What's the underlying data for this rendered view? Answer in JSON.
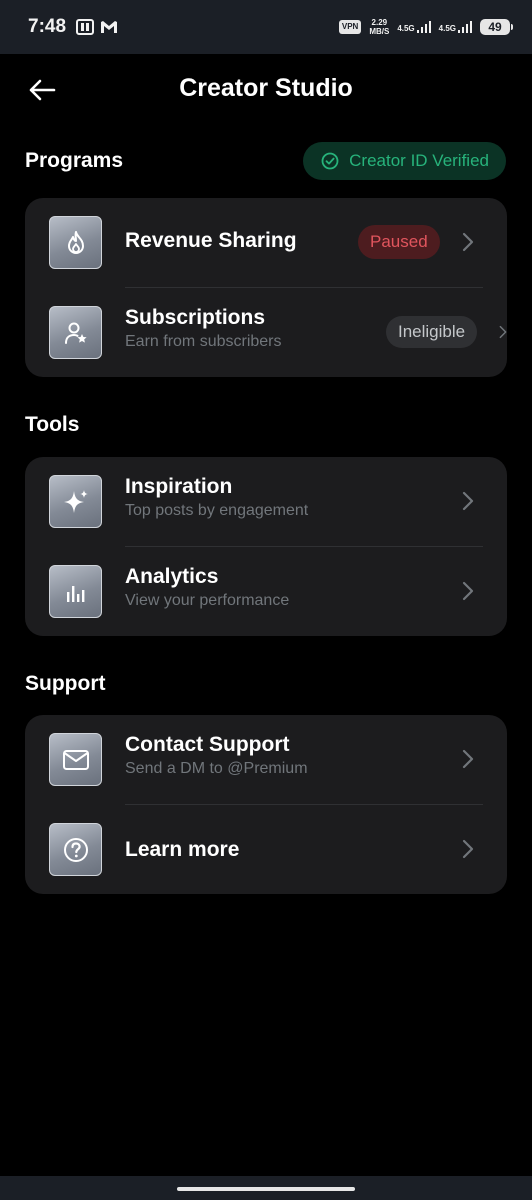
{
  "status_bar": {
    "time": "7:48",
    "vpn": "VPN",
    "speed_value": "2.29",
    "speed_unit": "MB/S",
    "network1": "4.5G",
    "network2": "4.5G",
    "battery": "49",
    "icons": [
      "paytm-icon",
      "gmail-icon",
      "signal-icon",
      "signal-icon"
    ]
  },
  "header": {
    "title": "Creator Studio",
    "back_icon": "arrow-left-icon"
  },
  "programs": {
    "section_title": "Programs",
    "verified_label": "Creator ID Verified",
    "verified_icon": "check-circle-icon",
    "items": [
      {
        "title": "Revenue Sharing",
        "subtitle": "",
        "badge": "Paused",
        "icon": "flame-icon"
      },
      {
        "title": "Subscriptions",
        "subtitle": "Earn from subscribers",
        "badge": "Ineligible",
        "icon": "person-star-icon"
      }
    ]
  },
  "tools": {
    "section_title": "Tools",
    "items": [
      {
        "title": "Inspiration",
        "subtitle": "Top posts by engagement",
        "icon": "sparkle-icon"
      },
      {
        "title": "Analytics",
        "subtitle": "View your performance",
        "icon": "bar-chart-icon"
      }
    ]
  },
  "support": {
    "section_title": "Support",
    "items": [
      {
        "title": "Contact Support",
        "subtitle": "Send a DM to @Premium",
        "icon": "envelope-icon"
      },
      {
        "title": "Learn more",
        "subtitle": "",
        "icon": "question-circle-icon"
      }
    ]
  },
  "colors": {
    "background": "#000000",
    "card": "#1c1c1e",
    "verified_green": "#27b37b",
    "paused_red": "#e0555d",
    "muted_text": "#71767b"
  }
}
